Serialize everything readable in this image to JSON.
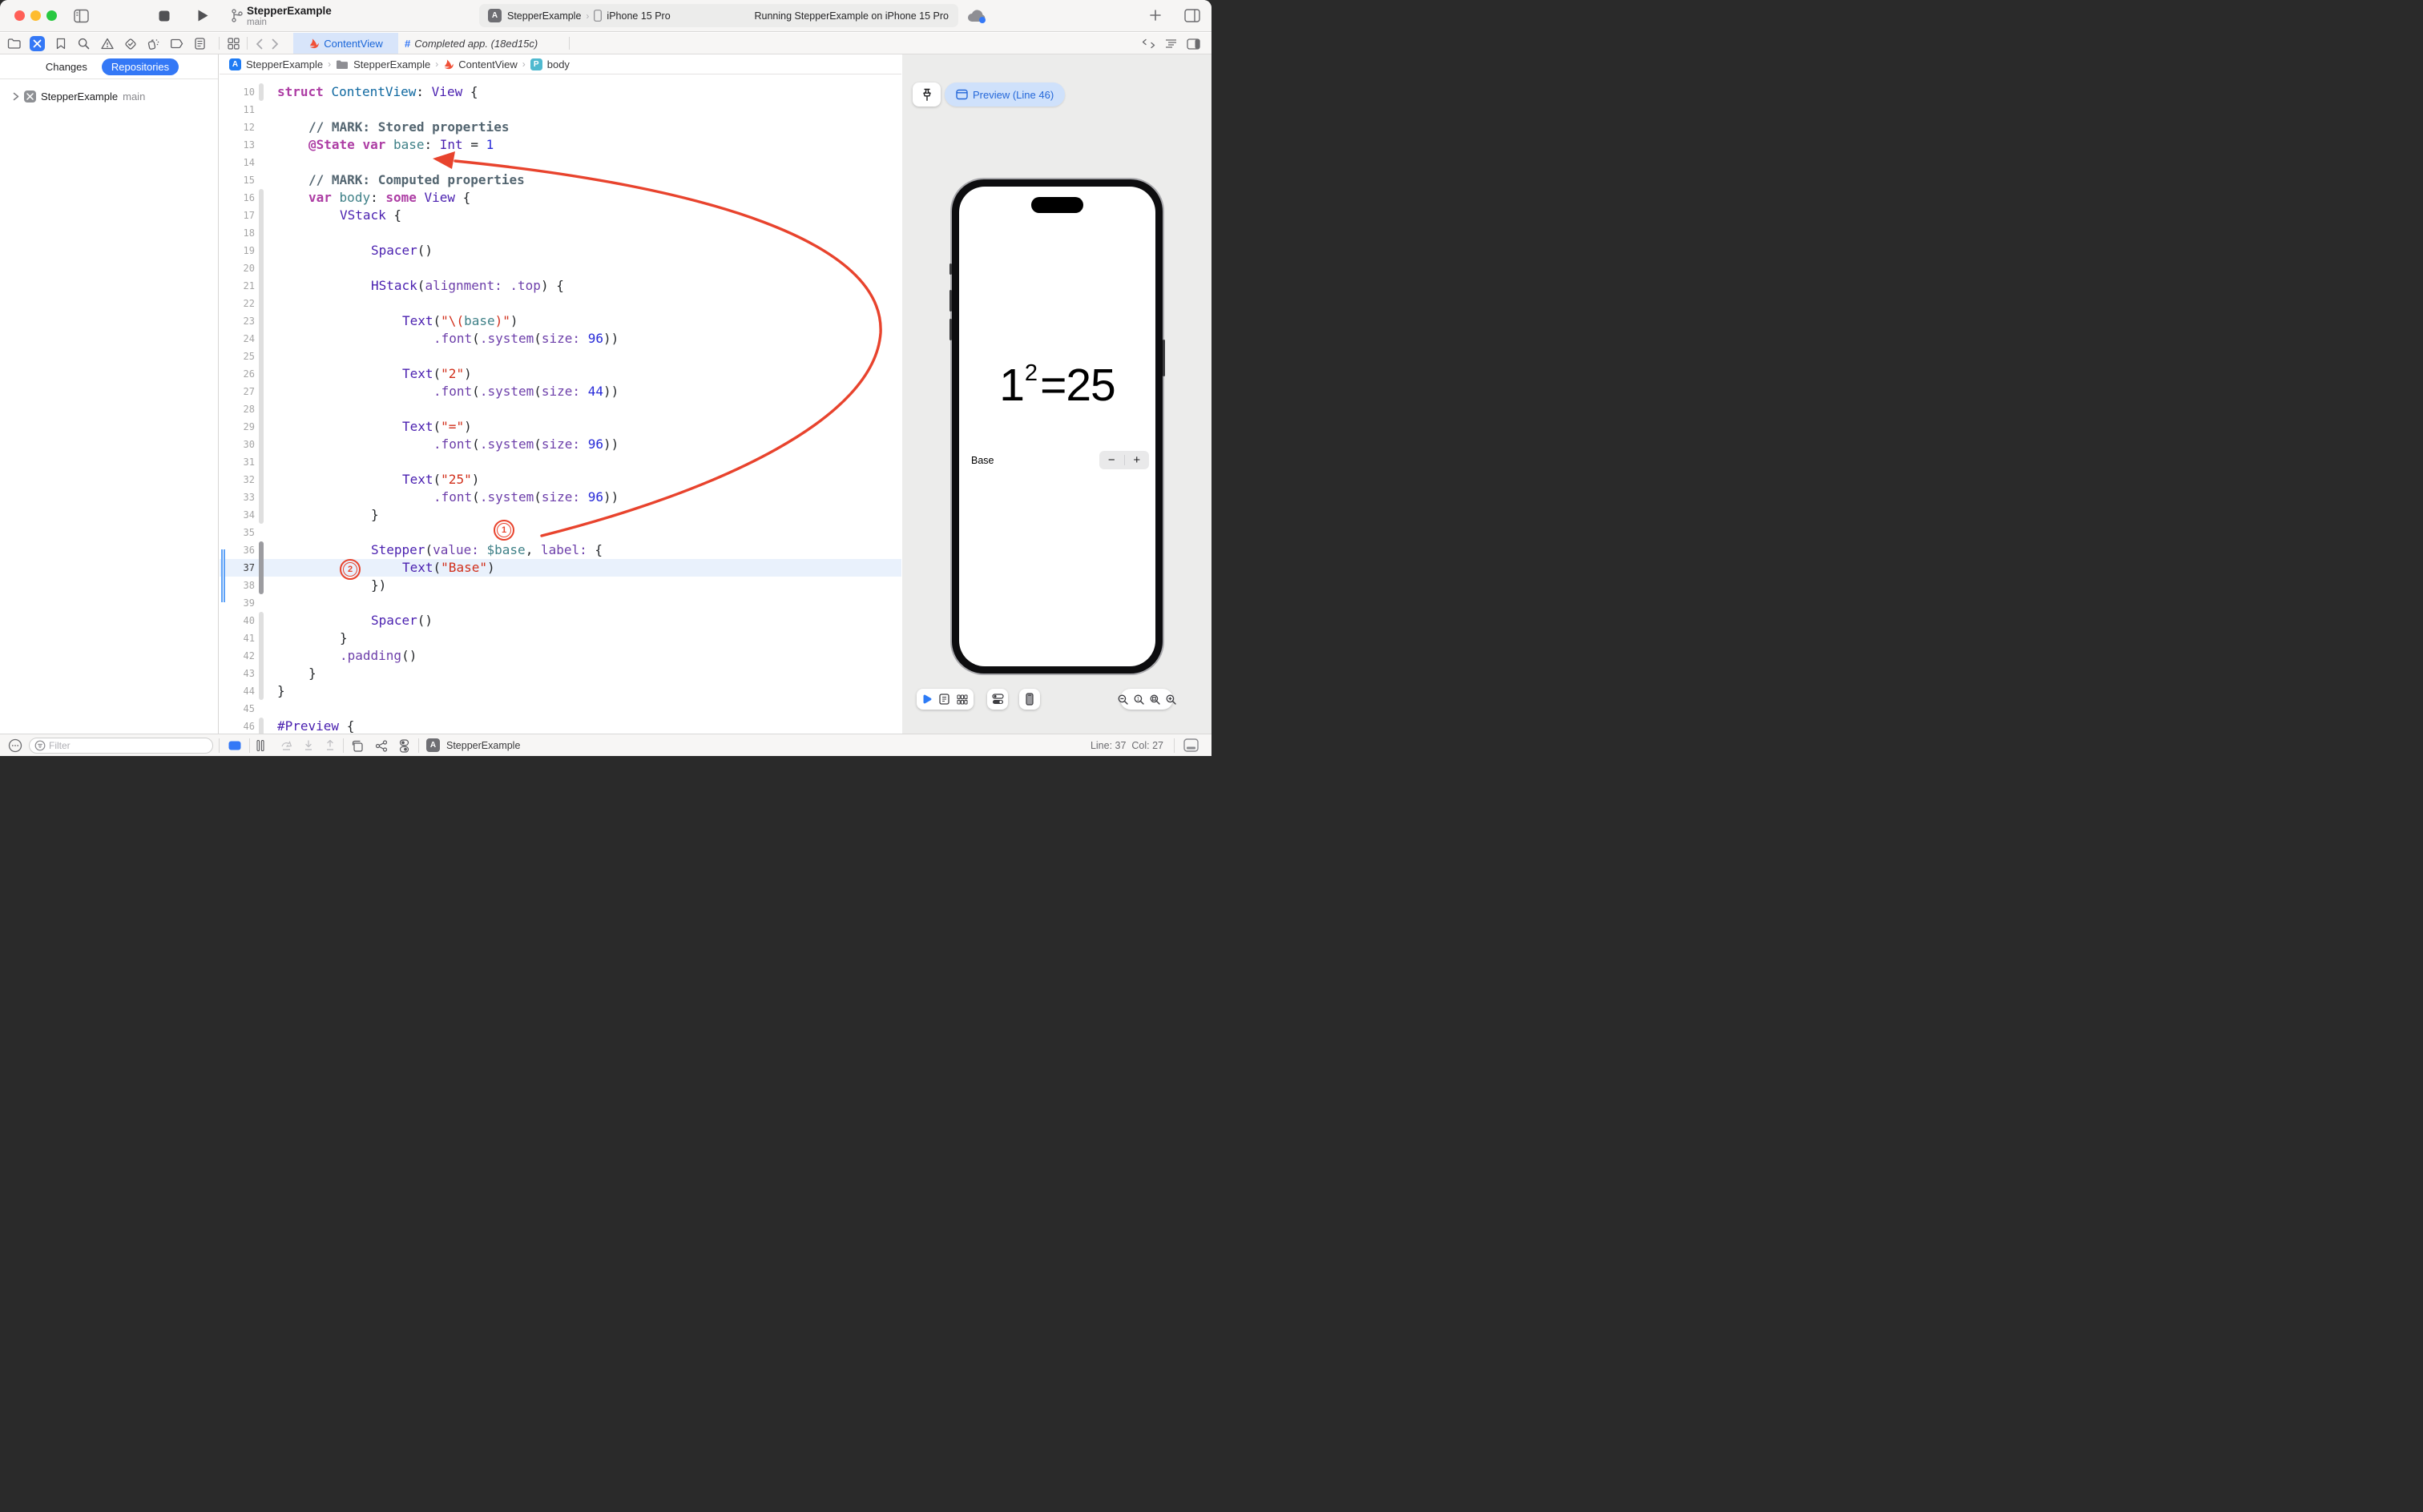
{
  "colors": {
    "accent": "#3478F6",
    "red": "#E8432D",
    "swift": "#F05138",
    "kw": "#AD3DA4",
    "type": "#4B21B0",
    "decl": "#0F68A0",
    "member": "#6D3FAA",
    "var": "#3E8087",
    "str": "#D12F1B",
    "num": "#272AD8",
    "comment": "#536570",
    "plain": "#25282B",
    "active_tab_bg": "#D8E5FA",
    "active_tab_text": "#1865D8",
    "canvas_bg": "#ECECEB",
    "highlight_line_bg": "#E9F1FC"
  },
  "window": {
    "title": "StepperExample",
    "subtitle": "main",
    "scheme": {
      "project": "StepperExample",
      "sep": "›",
      "device": "iPhone 15 Pro",
      "app_badge": "A"
    },
    "status": "Running StepperExample on iPhone 15 Pro"
  },
  "tabbar": {
    "active_tab": "ContentView",
    "inactive_tab": "Completed app. (18ed15c)",
    "inactive_prefix": "#"
  },
  "breadcrumb": {
    "sep": "›",
    "items": [
      {
        "label": "StepperExample",
        "badge": "A"
      },
      {
        "label": "StepperExample",
        "icon": "folder"
      },
      {
        "label": "ContentView",
        "icon": "swift"
      },
      {
        "label": "body",
        "badge": "P"
      }
    ]
  },
  "sidebar": {
    "tabs": {
      "changes": "Changes",
      "repositories": "Repositories"
    },
    "repo": {
      "name": "StepperExample",
      "branch": "main"
    }
  },
  "editor": {
    "annotations": {
      "labels": [
        "1",
        "2"
      ]
    },
    "lines": [
      {
        "n": 10,
        "i": 0,
        "strip": "l",
        "tk": [
          [
            "k",
            "struct"
          ],
          [
            "p",
            " "
          ],
          [
            "d",
            "ContentView"
          ],
          [
            "p",
            ": "
          ],
          [
            "t",
            "View"
          ],
          [
            "p",
            " {"
          ]
        ]
      },
      {
        "n": 11,
        "i": 0,
        "tk": []
      },
      {
        "n": 12,
        "i": 1,
        "tk": [
          [
            "c",
            "// MARK: Stored properties"
          ]
        ]
      },
      {
        "n": 13,
        "i": 1,
        "tk": [
          [
            "k",
            "@State"
          ],
          [
            "p",
            " "
          ],
          [
            "k",
            "var"
          ],
          [
            "p",
            " "
          ],
          [
            "v",
            "base"
          ],
          [
            "p",
            ": "
          ],
          [
            "t",
            "Int"
          ],
          [
            "p",
            " = "
          ],
          [
            "n",
            "1"
          ]
        ]
      },
      {
        "n": 14,
        "i": 0,
        "tk": []
      },
      {
        "n": 15,
        "i": 1,
        "tk": [
          [
            "c",
            "// MARK: Computed properties"
          ]
        ]
      },
      {
        "n": 16,
        "i": 1,
        "strip": "l",
        "tk": [
          [
            "k",
            "var"
          ],
          [
            "p",
            " "
          ],
          [
            "v",
            "body"
          ],
          [
            "p",
            ": "
          ],
          [
            "k",
            "some"
          ],
          [
            "p",
            " "
          ],
          [
            "t",
            "View"
          ],
          [
            "p",
            " {"
          ]
        ]
      },
      {
        "n": 17,
        "i": 2,
        "strip": "l",
        "tk": [
          [
            "t",
            "VStack"
          ],
          [
            "p",
            " {"
          ]
        ]
      },
      {
        "n": 18,
        "i": 0,
        "strip": "l",
        "tk": []
      },
      {
        "n": 19,
        "i": 3,
        "strip": "l",
        "tk": [
          [
            "t",
            "Spacer"
          ],
          [
            "p",
            "()"
          ]
        ]
      },
      {
        "n": 20,
        "i": 0,
        "strip": "l",
        "tk": []
      },
      {
        "n": 21,
        "i": 3,
        "strip": "l",
        "tk": [
          [
            "t",
            "HStack"
          ],
          [
            "p",
            "("
          ],
          [
            "m",
            "alignment:"
          ],
          [
            "p",
            " "
          ],
          [
            "m",
            ".top"
          ],
          [
            "p",
            ") {"
          ]
        ]
      },
      {
        "n": 22,
        "i": 0,
        "strip": "l",
        "tk": []
      },
      {
        "n": 23,
        "i": 4,
        "strip": "l",
        "tk": [
          [
            "t",
            "Text"
          ],
          [
            "p",
            "("
          ],
          [
            "s",
            "\"\\("
          ],
          [
            "v",
            "base"
          ],
          [
            "s",
            ")\""
          ],
          [
            "p",
            ")"
          ]
        ]
      },
      {
        "n": 24,
        "i": 5,
        "strip": "l",
        "tk": [
          [
            "m",
            ".font"
          ],
          [
            "p",
            "("
          ],
          [
            "m",
            ".system"
          ],
          [
            "p",
            "("
          ],
          [
            "m",
            "size:"
          ],
          [
            "p",
            " "
          ],
          [
            "n",
            "96"
          ],
          [
            "p",
            "))"
          ]
        ]
      },
      {
        "n": 25,
        "i": 0,
        "strip": "l",
        "tk": []
      },
      {
        "n": 26,
        "i": 4,
        "strip": "l",
        "tk": [
          [
            "t",
            "Text"
          ],
          [
            "p",
            "("
          ],
          [
            "s",
            "\"2\""
          ],
          [
            "p",
            ")"
          ]
        ]
      },
      {
        "n": 27,
        "i": 5,
        "strip": "l",
        "tk": [
          [
            "m",
            ".font"
          ],
          [
            "p",
            "("
          ],
          [
            "m",
            ".system"
          ],
          [
            "p",
            "("
          ],
          [
            "m",
            "size:"
          ],
          [
            "p",
            " "
          ],
          [
            "n",
            "44"
          ],
          [
            "p",
            "))"
          ]
        ]
      },
      {
        "n": 28,
        "i": 0,
        "strip": "l",
        "tk": []
      },
      {
        "n": 29,
        "i": 4,
        "strip": "l",
        "tk": [
          [
            "t",
            "Text"
          ],
          [
            "p",
            "("
          ],
          [
            "s",
            "\"=\""
          ],
          [
            "p",
            ")"
          ]
        ]
      },
      {
        "n": 30,
        "i": 5,
        "strip": "l",
        "tk": [
          [
            "m",
            ".font"
          ],
          [
            "p",
            "("
          ],
          [
            "m",
            ".system"
          ],
          [
            "p",
            "("
          ],
          [
            "m",
            "size:"
          ],
          [
            "p",
            " "
          ],
          [
            "n",
            "96"
          ],
          [
            "p",
            "))"
          ]
        ]
      },
      {
        "n": 31,
        "i": 0,
        "strip": "l",
        "tk": []
      },
      {
        "n": 32,
        "i": 4,
        "strip": "l",
        "tk": [
          [
            "t",
            "Text"
          ],
          [
            "p",
            "("
          ],
          [
            "s",
            "\"25\""
          ],
          [
            "p",
            ")"
          ]
        ]
      },
      {
        "n": 33,
        "i": 5,
        "strip": "l",
        "tk": [
          [
            "m",
            ".font"
          ],
          [
            "p",
            "("
          ],
          [
            "m",
            ".system"
          ],
          [
            "p",
            "("
          ],
          [
            "m",
            "size:"
          ],
          [
            "p",
            " "
          ],
          [
            "n",
            "96"
          ],
          [
            "p",
            "))"
          ]
        ]
      },
      {
        "n": 34,
        "i": 3,
        "strip": "l",
        "tk": [
          [
            "p",
            "}"
          ]
        ]
      },
      {
        "n": 35,
        "i": 0,
        "tk": []
      },
      {
        "n": 36,
        "i": 3,
        "strip": "d",
        "tk": [
          [
            "t",
            "Stepper"
          ],
          [
            "p",
            "("
          ],
          [
            "m",
            "value:"
          ],
          [
            "p",
            " "
          ],
          [
            "v",
            "$base"
          ],
          [
            "p",
            ", "
          ],
          [
            "m",
            "label:"
          ],
          [
            "p",
            " {"
          ]
        ]
      },
      {
        "n": 37,
        "i": 4,
        "strip": "d",
        "hl": true,
        "tk": [
          [
            "t",
            "Text"
          ],
          [
            "p",
            "("
          ],
          [
            "s",
            "\"Base\""
          ],
          [
            "p",
            ")"
          ]
        ]
      },
      {
        "n": 38,
        "i": 3,
        "strip": "d",
        "tk": [
          [
            "p",
            "})"
          ]
        ]
      },
      {
        "n": 39,
        "i": 0,
        "tk": []
      },
      {
        "n": 40,
        "i": 3,
        "strip": "l",
        "tk": [
          [
            "t",
            "Spacer"
          ],
          [
            "p",
            "()"
          ]
        ]
      },
      {
        "n": 41,
        "i": 2,
        "strip": "l",
        "tk": [
          [
            "p",
            "}"
          ]
        ]
      },
      {
        "n": 42,
        "i": 2,
        "strip": "l",
        "tk": [
          [
            "m",
            ".padding"
          ],
          [
            "p",
            "()"
          ]
        ]
      },
      {
        "n": 43,
        "i": 1,
        "strip": "l",
        "tk": [
          [
            "p",
            "}"
          ]
        ]
      },
      {
        "n": 44,
        "i": 0,
        "strip": "l",
        "tk": [
          [
            "p",
            "}"
          ]
        ]
      },
      {
        "n": 45,
        "i": 0,
        "tk": []
      },
      {
        "n": 46,
        "i": 0,
        "strip": "l",
        "tk": [
          [
            "t",
            "#Preview"
          ],
          [
            "p",
            " {"
          ]
        ]
      }
    ]
  },
  "canvas": {
    "preview_button": "Preview (Line 46)",
    "phone": {
      "expression": {
        "base": "1",
        "exponent": "2",
        "equals": "=",
        "result": "25"
      },
      "stepper": {
        "label": "Base",
        "minus": "−",
        "plus": "+"
      }
    }
  },
  "bottombar": {
    "filter_placeholder": "Filter",
    "project": "StepperExample",
    "line": "Line: 37",
    "col": "Col: 27"
  },
  "icons": [
    "close-icon",
    "minimize-icon",
    "zoom-icon",
    "sidebar-toggle-icon",
    "stop-icon",
    "run-icon",
    "branch-icon",
    "cloud-icon",
    "add-tab-icon",
    "inspector-toggle-icon",
    "project-navigator-icon",
    "source-control-navigator-icon",
    "bookmark-navigator-icon",
    "find-navigator-icon",
    "issue-navigator-icon",
    "test-navigator-icon",
    "debug-navigator-icon",
    "breakpoint-navigator-icon",
    "report-navigator-icon",
    "tab-overview-icon",
    "back-icon",
    "forward-icon",
    "swift-icon",
    "code-review-icon",
    "minimap-icon",
    "editor-options-icon",
    "pin-icon",
    "canvas-icon",
    "live-preview-icon",
    "selectable-icon",
    "variants-icon",
    "device-settings-icon",
    "preview-on-device-icon",
    "zoom-out-icon",
    "zoom-actual-icon",
    "zoom-fit-icon",
    "zoom-in-icon",
    "more-icon",
    "filter-icon",
    "breakpoints-toggle-icon",
    "debug-bar-icon",
    "jump-icon",
    "pull-icon",
    "push-icon",
    "layers-icon",
    "hierarchy-icon",
    "segments-icon",
    "app-icon",
    "editor-layout-icon"
  ]
}
